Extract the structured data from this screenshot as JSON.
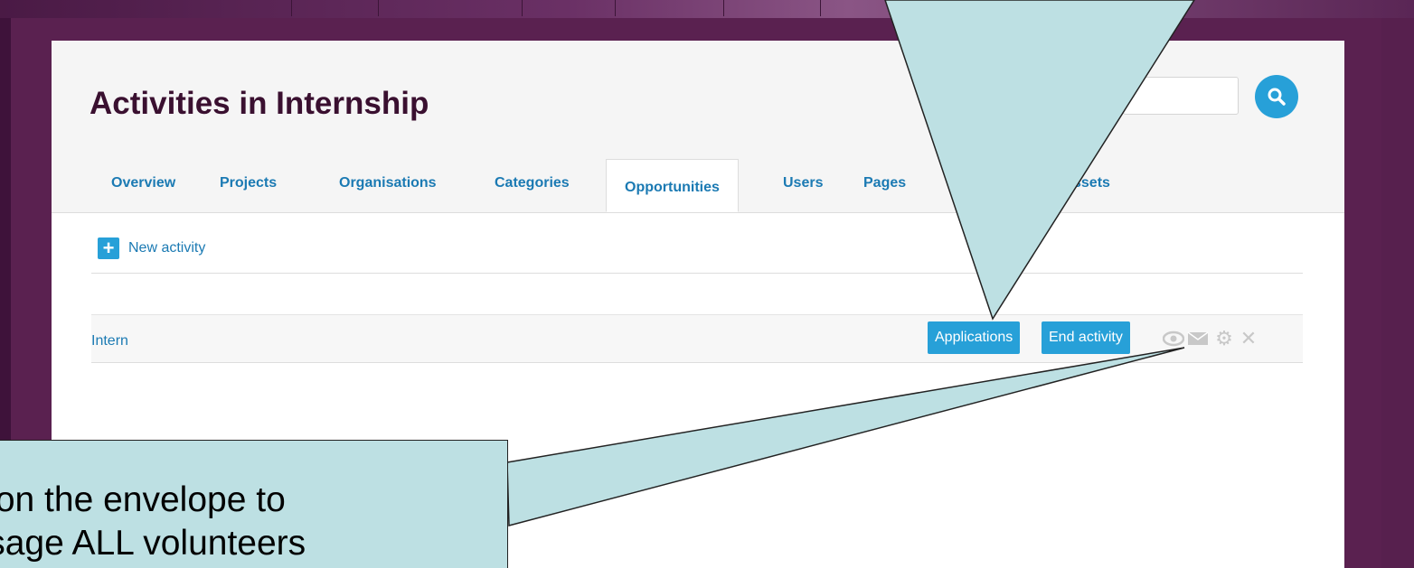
{
  "page": {
    "title": "Activities in Internship",
    "search": {
      "placeholder": ""
    },
    "tabs": [
      {
        "label": "Overview",
        "active": false
      },
      {
        "label": "Projects",
        "active": false
      },
      {
        "label": "Organisations",
        "active": false
      },
      {
        "label": "Categories",
        "active": false
      },
      {
        "label": "Opportunities",
        "active": true
      },
      {
        "label": "Users",
        "active": false
      },
      {
        "label": "Pages",
        "active": false
      },
      {
        "label": "ssets",
        "active": false
      }
    ],
    "new_activity_label": "New activity",
    "activities": [
      {
        "name": "Intern",
        "applications_label": "Applications",
        "end_activity_label": "End activity",
        "icons": [
          "eye-icon",
          "envelope-icon",
          "gear-icon",
          "close-icon"
        ]
      }
    ]
  },
  "callout": {
    "line1": "ck on the envelope to",
    "line2": "essage ALL volunteers"
  },
  "colors": {
    "accent": "#27a0d8",
    "link": "#1b7ab3",
    "title": "#3a1030",
    "background": "#5a2150",
    "callout_fill": "#bde0e3"
  }
}
